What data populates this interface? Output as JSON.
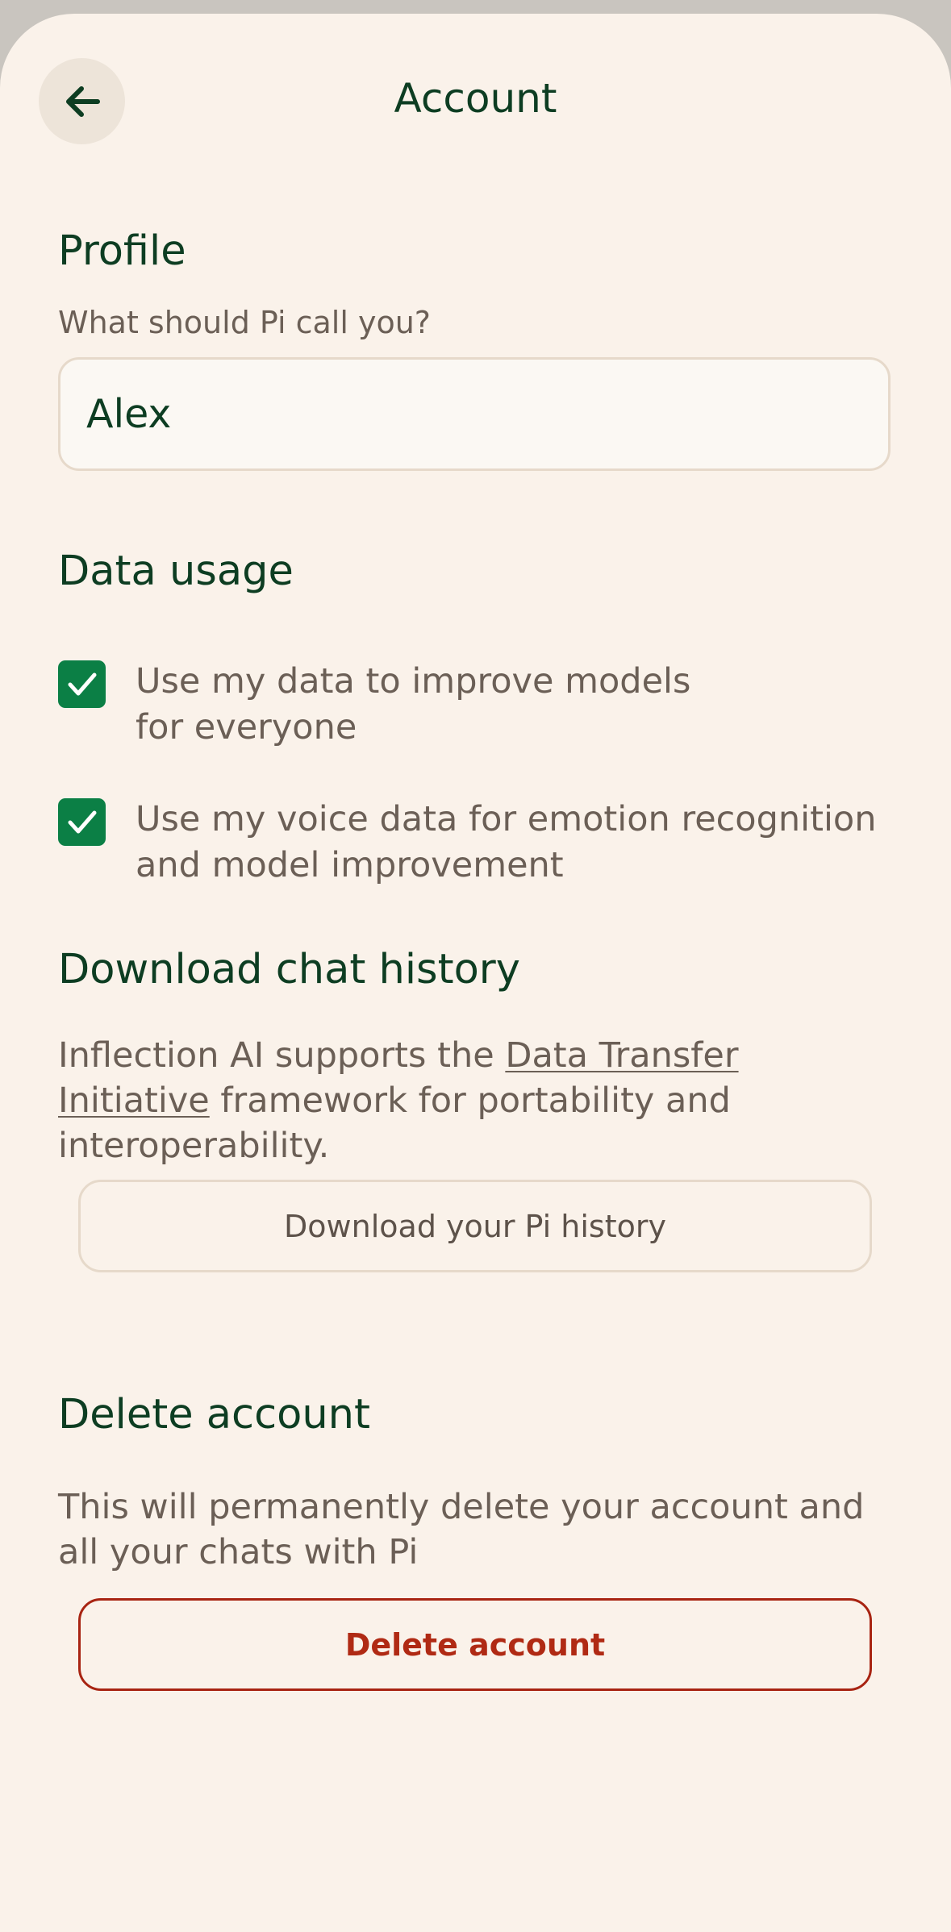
{
  "header": {
    "title": "Account",
    "back_icon": "arrow-left-icon"
  },
  "profile": {
    "heading": "Profile",
    "name_label": "What should Pi call you?",
    "name_value": "Alex"
  },
  "data_usage": {
    "heading": "Data usage",
    "options": [
      {
        "label": "Use my data to improve models\nfor everyone",
        "checked": true
      },
      {
        "label": "Use my voice data for emotion recognition\nand model improvement",
        "checked": true
      }
    ]
  },
  "download": {
    "heading": "Download chat history",
    "text_before": "Inflection AI supports the ",
    "link_text": "Data Transfer Initiative",
    "text_after": " framework for portability and interoperability.",
    "button_label": "Download your Pi history"
  },
  "delete": {
    "heading": "Delete account",
    "description": "This will permanently delete your account and all your chats with Pi",
    "button_label": "Delete account"
  },
  "colors": {
    "accent_green": "#0b7f45",
    "heading_green": "#0d3d22",
    "danger_red": "#b02a14",
    "background": "#faf2ea"
  }
}
